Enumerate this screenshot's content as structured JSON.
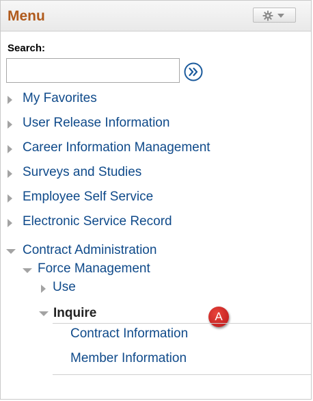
{
  "header": {
    "title": "Menu"
  },
  "icons": {
    "gear": "gear-icon",
    "dropdown": "caret-down-icon",
    "go": "double-chevron-right-icon",
    "collapsed": "triangle-right-icon",
    "expanded": "triangle-down-icon"
  },
  "search": {
    "label": "Search:",
    "value": ""
  },
  "menu": {
    "items": [
      {
        "label": "My Favorites"
      },
      {
        "label": "User Release Information"
      },
      {
        "label": "Career Information Management"
      },
      {
        "label": "Surveys and Studies"
      },
      {
        "label": "Employee Self Service"
      },
      {
        "label": "Electronic Service Record"
      },
      {
        "label": "Contract Administration"
      }
    ],
    "force_management": {
      "label": "Force Management"
    },
    "use": {
      "label": "Use"
    },
    "inquire": {
      "label": "Inquire"
    },
    "inquire_children": [
      {
        "label": "Contract Information"
      },
      {
        "label": "Member Information"
      }
    ]
  },
  "callout": {
    "label": "A",
    "color": "#c8201f"
  },
  "colors": {
    "link": "#0f4a8a",
    "header_title": "#b05a1c"
  }
}
